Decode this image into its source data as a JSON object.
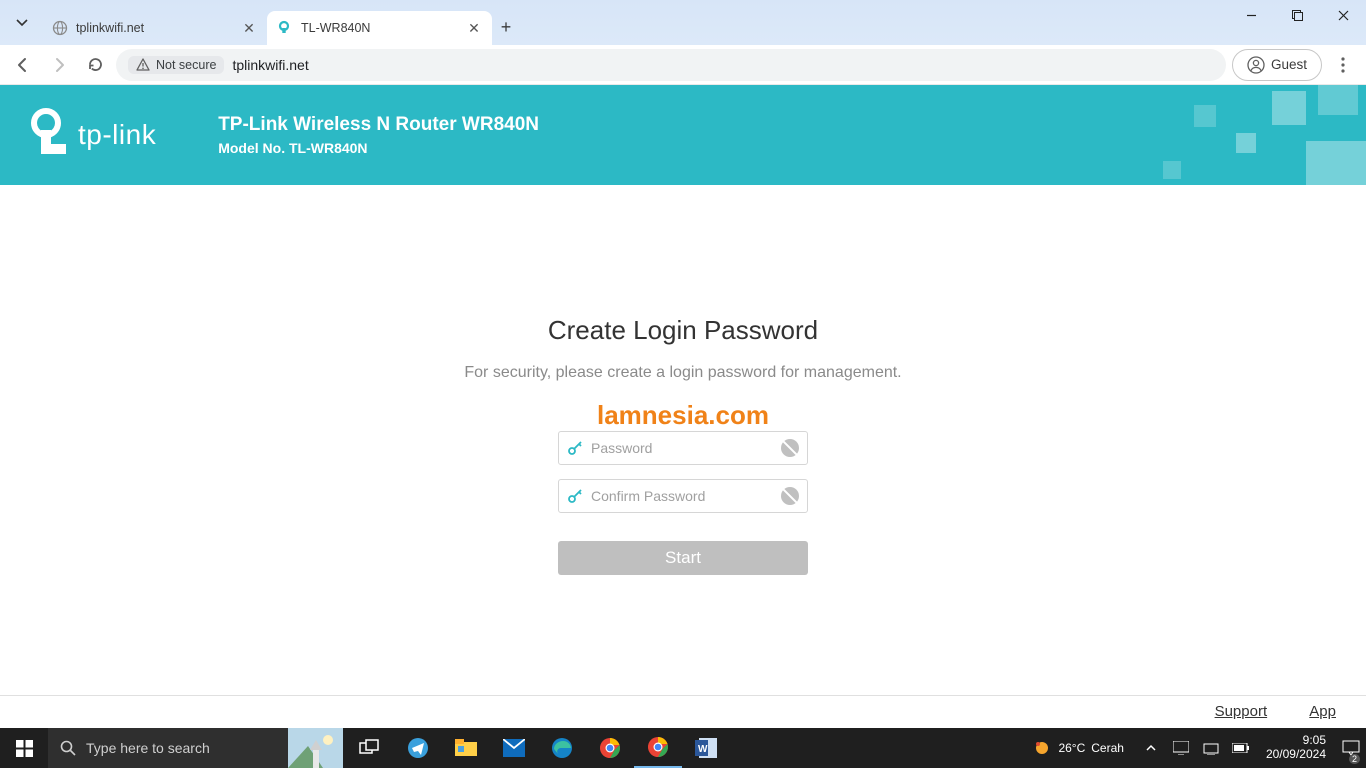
{
  "browser": {
    "tabs": [
      {
        "title": "tplinkwifi.net",
        "active": false
      },
      {
        "title": "TL-WR840N",
        "active": true
      }
    ],
    "nav": {
      "security_label": "Not secure",
      "url": "tplinkwifi.net",
      "profile_label": "Guest"
    },
    "window_controls": {
      "min": "—",
      "max": "▢",
      "close": "✕"
    }
  },
  "router": {
    "brand": "tp-link",
    "title": "TP-Link Wireless N Router WR840N",
    "model": "Model No. TL-WR840N",
    "login": {
      "heading": "Create Login Password",
      "subheading": "For security, please create a login password for management.",
      "watermark": "lamnesia.com",
      "password_placeholder": "Password",
      "confirm_placeholder": "Confirm Password",
      "start_label": "Start"
    },
    "footer": {
      "support": "Support",
      "app": "App"
    }
  },
  "taskbar": {
    "search_placeholder": "Type here to search",
    "weather_temp": "26°C",
    "weather_desc": "Cerah",
    "time": "9:05",
    "date": "20/09/2024",
    "notif_count": "2"
  }
}
